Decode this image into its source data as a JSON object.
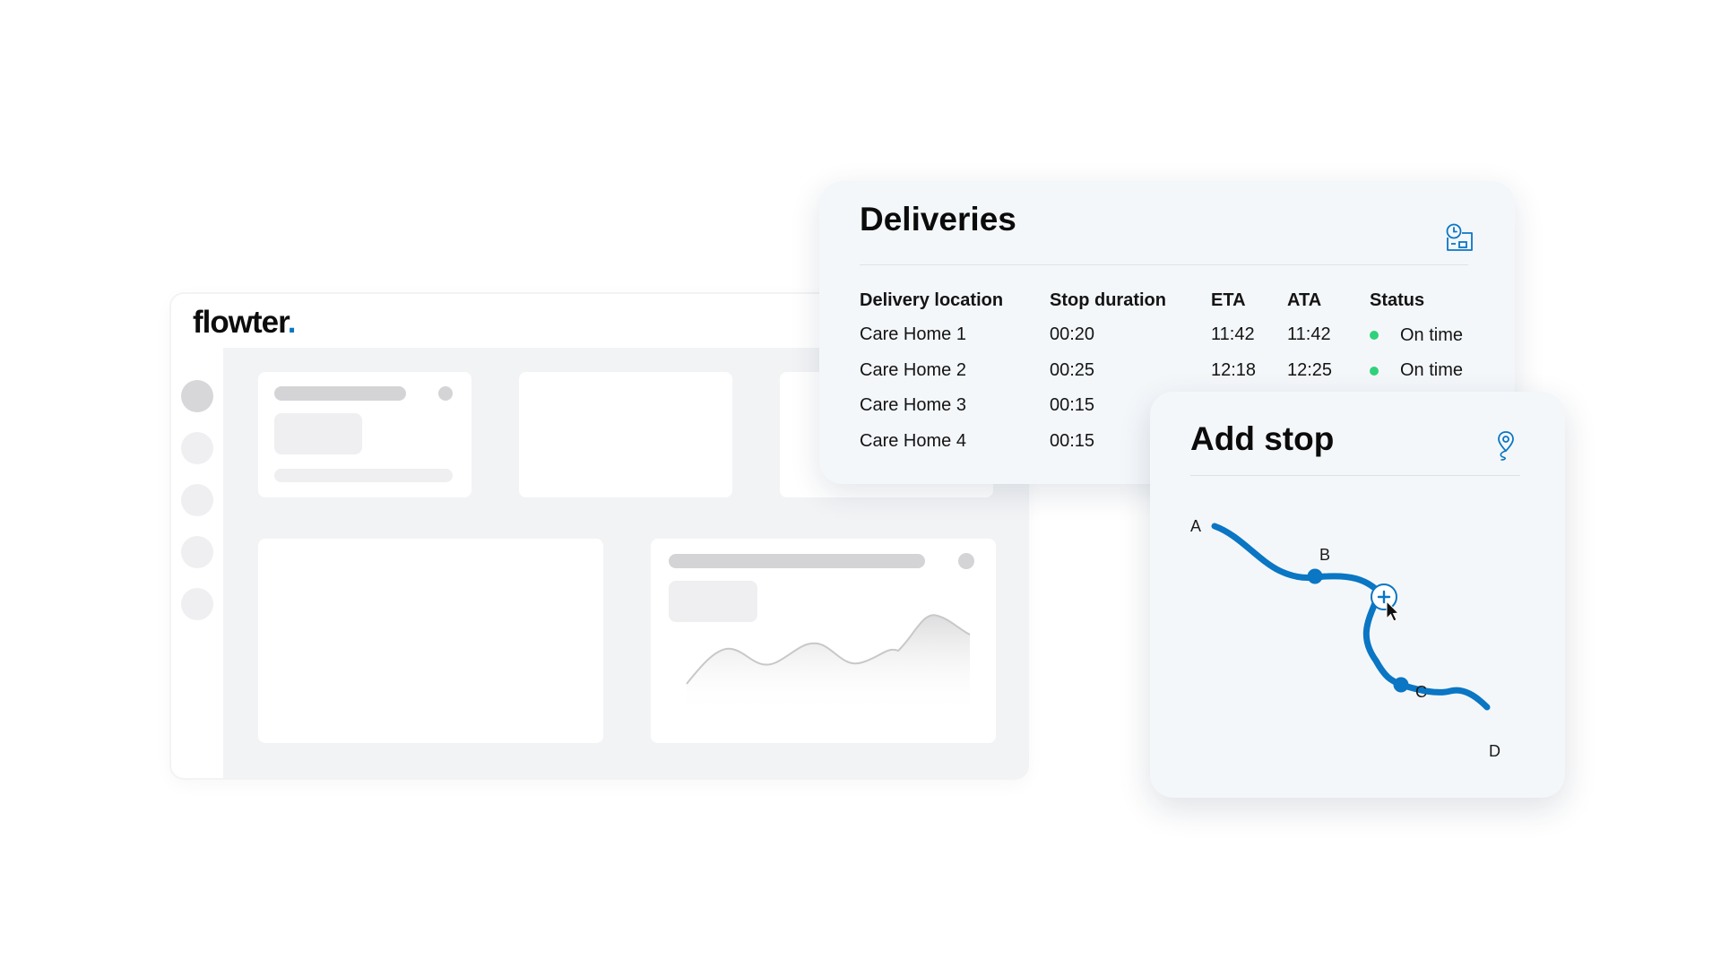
{
  "brand": {
    "name": "flowter",
    "dot": ".",
    "accent": "#0a76c4"
  },
  "deliveries": {
    "title": "Deliveries",
    "icon": "schedule-icon",
    "columns": [
      "Delivery location",
      "Stop duration",
      "ETA",
      "ATA",
      "Status"
    ],
    "rows": [
      {
        "location": "Care Home 1",
        "duration": "00:20",
        "eta": "11:42",
        "ata": "11:42",
        "status": "On time"
      },
      {
        "location": "Care Home 2",
        "duration": "00:25",
        "eta": "12:18",
        "ata": "12:25",
        "status": "On time"
      },
      {
        "location": "Care Home 3",
        "duration": "00:15",
        "eta": "",
        "ata": "",
        "status": ""
      },
      {
        "location": "Care Home 4",
        "duration": "00:15",
        "eta": "",
        "ata": "",
        "status": ""
      }
    ],
    "status_color": "#2fd27a"
  },
  "add_stop": {
    "title": "Add stop",
    "icon": "map-pin-icon",
    "points": [
      "A",
      "B",
      "C",
      "D"
    ],
    "route_color": "#0a76c4"
  }
}
